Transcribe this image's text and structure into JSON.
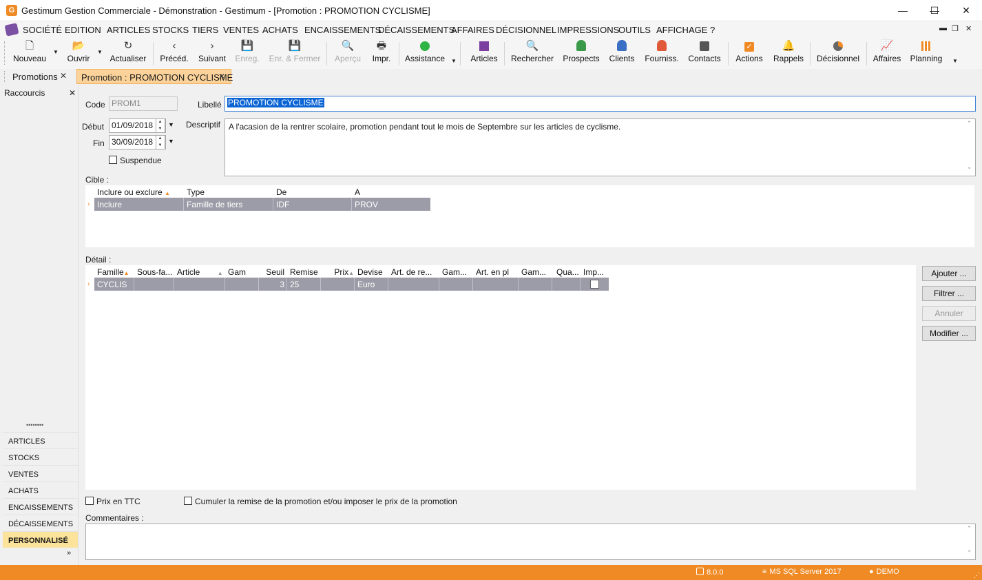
{
  "window": {
    "title": "Gestimum Gestion Commerciale - Démonstration - Gestimum - [Promotion : PROMOTION CYCLISME]",
    "app_icon_letter": "G",
    "minimize": "—",
    "maximize": "☐",
    "close": "✕"
  },
  "menu": {
    "items": [
      "SOCIÉTÉ",
      "EDITION",
      "ARTICLES",
      "STOCKS",
      "TIERS",
      "VENTES",
      "ACHATS",
      "ENCAISSEMENTS",
      "DÉCAISSEMENTS",
      "AFFAIRES",
      "DÉCISIONNEL",
      "IMPRESSIONS",
      "OUTILS",
      "AFFICHAGE",
      "?"
    ],
    "mdi_controls": [
      "▬",
      "❐",
      "✕"
    ]
  },
  "toolbar": {
    "nouveau": "Nouveau",
    "ouvrir": "Ouvrir",
    "actualiser": "Actualiser",
    "preced": "Précéd.",
    "suivant": "Suivant",
    "enreg": "Enreg.",
    "enr_fermer": "Enr. & Fermer",
    "apercu": "Aperçu",
    "impr": "Impr.",
    "assistance": "Assistance",
    "articles": "Articles",
    "rechercher": "Rechercher",
    "prospects": "Prospects",
    "clients": "Clients",
    "fourniss": "Fourniss.",
    "contacts": "Contacts",
    "actions": "Actions",
    "rappels": "Rappels",
    "decisionnel": "Décisionnel",
    "affaires": "Affaires",
    "planning": "Planning"
  },
  "colors": {
    "accent": "#f08a24",
    "articles_icon": "#7b3fa0",
    "prospects_icon": "#3a9a4a",
    "clients_icon": "#3a6fc4",
    "fourniss_icon": "#e05a3a",
    "selected_row": "#9c9ca8",
    "active_tab": "#fbd39a"
  },
  "tabs": {
    "promotions": "Promotions",
    "active": "Promotion : PROMOTION CYCLISME",
    "close": "✕"
  },
  "sidebar": {
    "title": "Raccourcis",
    "close": "✕",
    "grip": "••••••••",
    "items": [
      "ARTICLES",
      "STOCKS",
      "VENTES",
      "ACHATS",
      "ENCAISSEMENTS",
      "DÉCAISSEMENTS",
      "PERSONNALISÉ"
    ],
    "more": "»"
  },
  "form": {
    "code_label": "Code",
    "code_value": "PROM1",
    "libelle_label": "Libellé",
    "libelle_value": "PROMOTION CYCLISME",
    "debut_label": "Début",
    "debut_value": "01/09/2018",
    "fin_label": "Fin",
    "fin_value": "30/09/2018",
    "suspendue_label": "Suspendue",
    "descriptif_label": "Descriptif",
    "descriptif_value": "A l'acasion de la rentrer scolaire, promotion pendant tout le mois de Septembre sur les articles de cyclisme.",
    "cible_label": "Cible :",
    "detail_label": "Détail :",
    "prix_ttc_label": "Prix en TTC",
    "cumuler_label": "Cumuler la remise de la promotion et/ou imposer le prix de la promotion",
    "commentaires_label": "Commentaires :"
  },
  "cible_grid": {
    "columns": [
      "Inclure ou exclure",
      "Type",
      "De",
      "A"
    ],
    "rows": [
      [
        "Inclure",
        "Famille de tiers",
        "IDF",
        "PROV"
      ]
    ]
  },
  "detail_grid": {
    "columns": [
      "Famille",
      "Sous-fa...",
      "Article",
      "Gam",
      "Seuil",
      "Remise",
      "Prix",
      "Devise",
      "Art. de re...",
      "Gam...",
      "Art. en pl",
      "Gam...",
      "Qua...",
      "Imp..."
    ],
    "rows": [
      [
        "CYCLIS",
        "",
        "",
        "",
        "3",
        "25",
        "",
        "Euro",
        "",
        "",
        "",
        "",
        "",
        ""
      ]
    ]
  },
  "buttons": {
    "ajouter": "Ajouter ...",
    "filtrer": "Filtrer ...",
    "annuler": "Annuler",
    "modifier": "Modifier ..."
  },
  "status": {
    "version": "8.0.0",
    "server": "MS SQL Server 2017",
    "user": "DEMO"
  }
}
